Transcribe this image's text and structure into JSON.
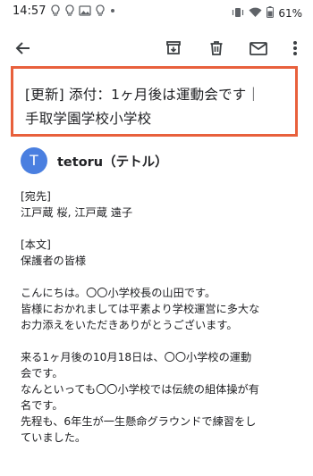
{
  "status_bar": {
    "time": "14:57",
    "battery": "61%",
    "left_icons": [
      "bulb-icon",
      "bulb-icon",
      "image-icon",
      "bulb-icon",
      "dot-icon"
    ],
    "right_icons": [
      "vibrate-icon",
      "wifi-icon",
      "battery-icon"
    ]
  },
  "toolbar": {
    "actions": [
      "back-icon",
      "archive-icon",
      "delete-icon",
      "mail-icon",
      "more-vert-icon"
    ]
  },
  "subject": {
    "line1": "[更新] 添付：1ヶ月後は運動会です｜",
    "line2": "手取学園学校小学校",
    "highlight_color": "#e8603c"
  },
  "sender": {
    "avatar_letter": "T",
    "avatar_color": "#4a7fe0",
    "name": "tetoru（テトル）"
  },
  "message": {
    "recipients_label": "[宛先]",
    "recipients": "江戸蔵 桜, 江戸蔵 遠子",
    "body_label": "[本文]",
    "salutation": "保護者の皆様",
    "para1_line1": "こんにちは。〇〇小学校長の山田です。",
    "para1_line2": "皆様におかれましては平素より学校運営に多大な",
    "para1_line3": "お力添えをいただきありがとうございます。",
    "para2_line1": "来る1ヶ月後の10月18日は、〇〇小学校の運動",
    "para2_line2": "会です。",
    "para2_line3": "なんといっても〇〇小学校では伝統の組体操が有",
    "para2_line4": "名です。",
    "para2_line5": "先程も、6年生が一生懸命グラウンドで練習をし",
    "para2_line6": "ていました。"
  }
}
